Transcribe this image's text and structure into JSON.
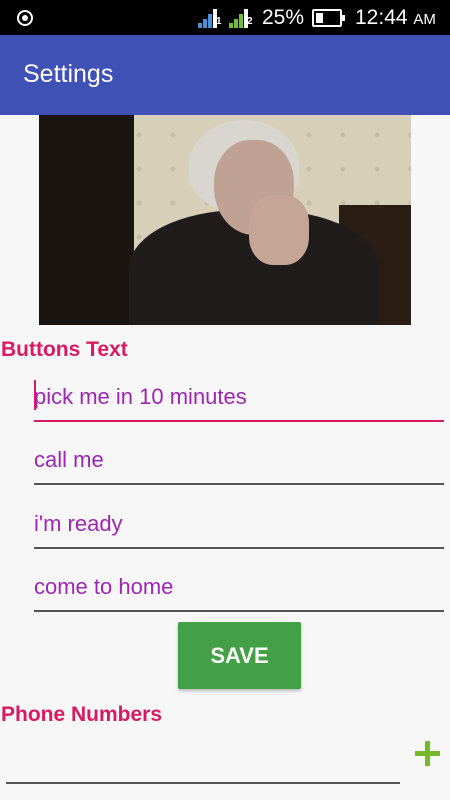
{
  "status_bar": {
    "battery_percent": "25%",
    "time": "12:44",
    "ampm": "AM",
    "sim1_label": "1",
    "sim2_label": "2"
  },
  "app_bar": {
    "title": "Settings"
  },
  "photo": {
    "description_icon": "portrait-photo"
  },
  "buttons_section": {
    "label": "Buttons Text",
    "fields": [
      {
        "value": "pick me in 10 minutes"
      },
      {
        "value": "call me"
      },
      {
        "value": "i'm ready"
      },
      {
        "value": "come to home"
      }
    ],
    "save_label": "SAVE"
  },
  "phones_section": {
    "label": "Phone Numbers",
    "phone_value": "",
    "add_icon": "plus-icon"
  },
  "colors": {
    "app_bar": "#3f51b5",
    "accent": "#d81b60",
    "field_text": "#9c27b0",
    "save_button": "#43a047",
    "add_icon": "#76b82a"
  }
}
